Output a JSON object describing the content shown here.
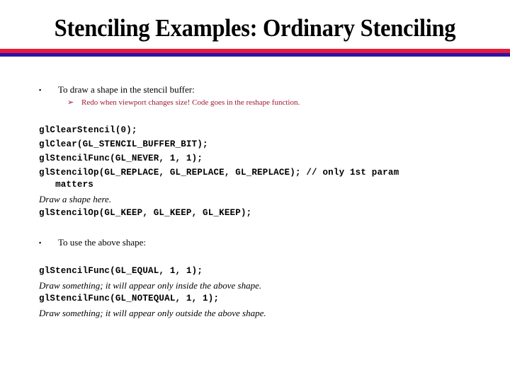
{
  "slide": {
    "title": "Stenciling Examples: Ordinary Stenciling",
    "colors": {
      "rule_top": "#e81c3a",
      "rule_bottom": "#2d14a8",
      "sub_bullet": "#a0182e"
    },
    "bullets": [
      {
        "marker": "▪",
        "text": "To draw a shape in the stencil buffer:"
      },
      {
        "marker": "▪",
        "text": "To use the above shape:"
      }
    ],
    "sub_bullet": {
      "marker": "➢",
      "text": "Redo when viewport changes size! Code goes in the reshape function."
    },
    "block1": {
      "line1": "glClearStencil(0);",
      "line2": "glClear(GL_STENCIL_BUFFER_BIT);",
      "line3": "glStencilFunc(GL_NEVER, 1, 1);",
      "line4": "glStencilOp(GL_REPLACE, GL_REPLACE, GL_REPLACE); // only 1st param",
      "line5": "   matters",
      "note1": "Draw a shape here.",
      "line6": "glStencilOp(GL_KEEP, GL_KEEP, GL_KEEP);"
    },
    "block2": {
      "line1": "glStencilFunc(GL_EQUAL, 1, 1);",
      "note1": "Draw something; it will appear only inside the above shape.",
      "line2": "glStencilFunc(GL_NOTEQUAL, 1, 1);",
      "note2": "Draw something; it will appear only outside the above shape."
    }
  }
}
